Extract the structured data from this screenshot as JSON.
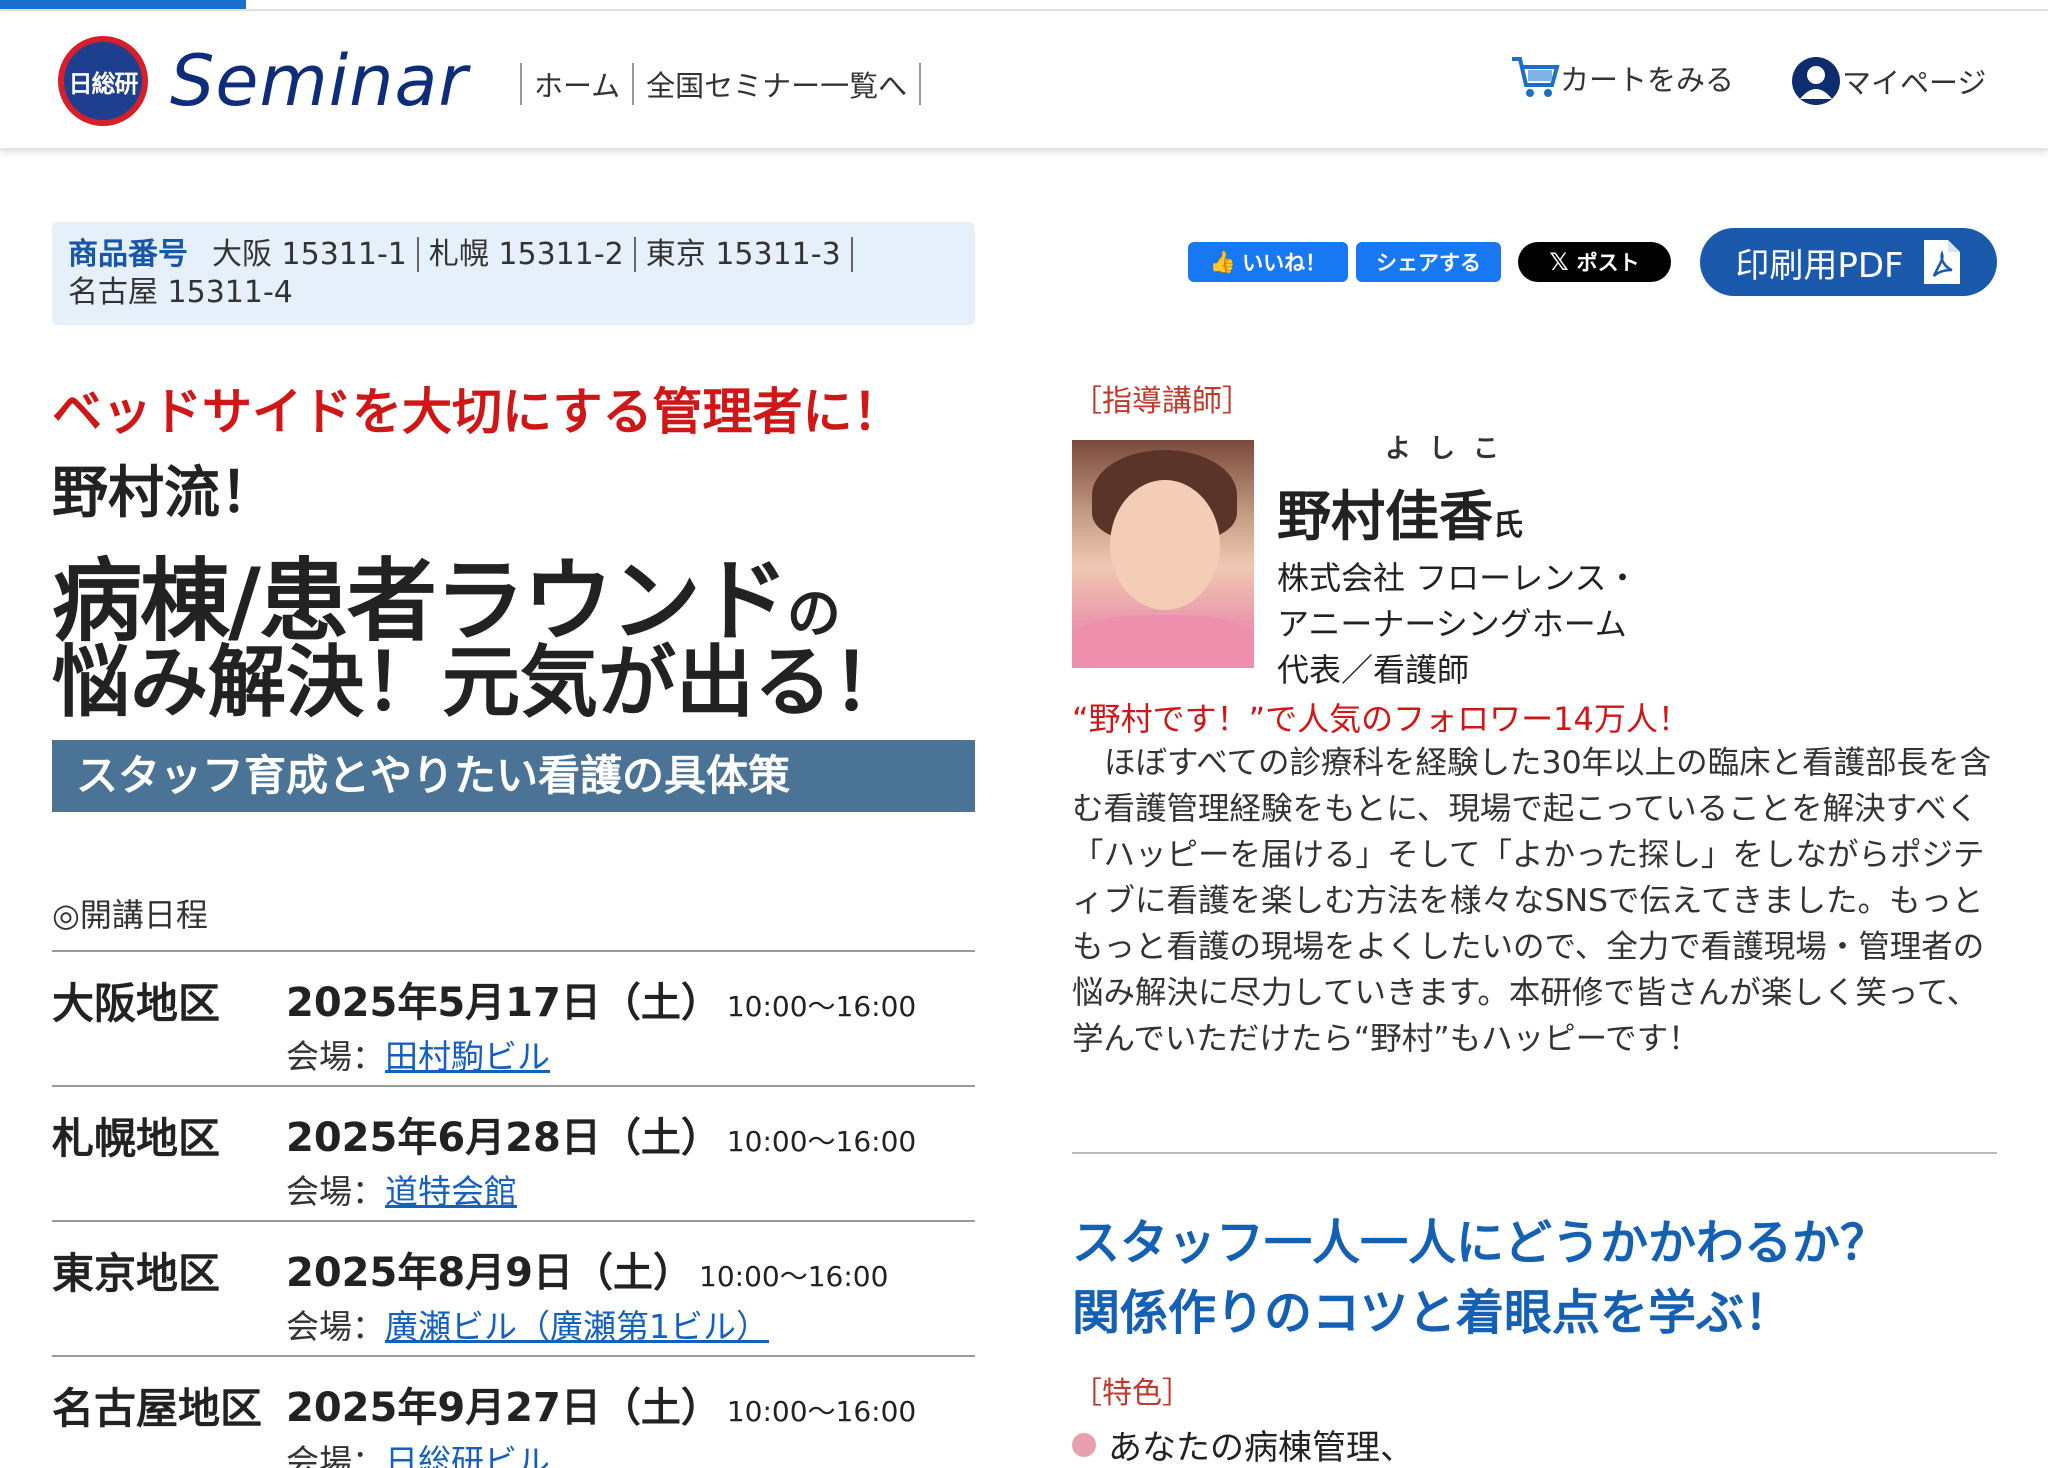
{
  "header": {
    "logo_badge": "日総研",
    "logo_text": "Seminar",
    "nav": [
      "ホーム",
      "全国セミナー一覧へ"
    ],
    "cart_label": "カートをみる",
    "mypage_label": "マイページ"
  },
  "product": {
    "label": "商品番号",
    "codes": [
      "大阪 15311-1",
      "札幌 15311-2",
      "東京 15311-3",
      "名古屋 15311-4"
    ]
  },
  "social": {
    "like": "いいね！",
    "share": "シェアする",
    "post": "ポスト",
    "pdf": "印刷用PDF"
  },
  "title": {
    "catch": "ベッドサイドを大切にする管理者に！",
    "line1": "野村流！",
    "line2_main": "病棟/患者ラウンド",
    "line2_suffix": "の",
    "line3": "悩み解決！元気が出る！",
    "subtitle": "スタッフ育成とやりたい看護の具体策"
  },
  "schedule": {
    "heading": "◎開講日程",
    "venue_label": "会場：",
    "items": [
      {
        "region": "大阪地区",
        "date": "2025年5月17日（土）",
        "time": "10:00〜16:00",
        "venue": "田村駒ビル"
      },
      {
        "region": "札幌地区",
        "date": "2025年6月28日（土）",
        "time": "10:00〜16:00",
        "venue": "道特会館"
      },
      {
        "region": "東京地区",
        "date": "2025年8月9日（土）",
        "time": "10:00〜16:00",
        "venue": "廣瀬ビル（廣瀬第1ビル）"
      },
      {
        "region": "名古屋地区",
        "date": "2025年9月27日（土）",
        "time": "10:00〜16:00",
        "venue": "日総研ビル"
      }
    ]
  },
  "instructor": {
    "label": "［指導講師］",
    "ruby": "よしこ",
    "name": "野村佳香",
    "honorific": "氏",
    "affiliation": [
      "株式会社 フローレンス・",
      "アニーナーシングホーム",
      "代表／看護師"
    ],
    "highlight": "“野村です！”で人気のフォロワー14万人！",
    "description": "ほぼすべての診療科を経験した30年以上の臨床と看護部長を含む看護管理経験をもとに、現場で起こっていることを解決すべく「ハッピーを届ける」そして「よかった探し」をしながらポジティブに看護を楽しむ方法を様々なSNSで伝えてきました。もっともっと看護の現場をよくしたいので、全力で看護現場・管理者の悩み解決に尽力していきます。本研修で皆さんが楽しく笑って、学んでいただけたら“野村”もハッピーです！"
  },
  "headline": {
    "line1": "スタッフ一人一人にどうかかわるか？",
    "line2": "関係作りのコツと着眼点を学ぶ！"
  },
  "features": {
    "label": "［特色］",
    "items": [
      "あなたの病棟管理、"
    ]
  },
  "colors": {
    "brand_blue": "#1b59ad",
    "accent_red": "#d01717",
    "subtitle_bar": "#4a7396",
    "link": "#1460c0"
  }
}
